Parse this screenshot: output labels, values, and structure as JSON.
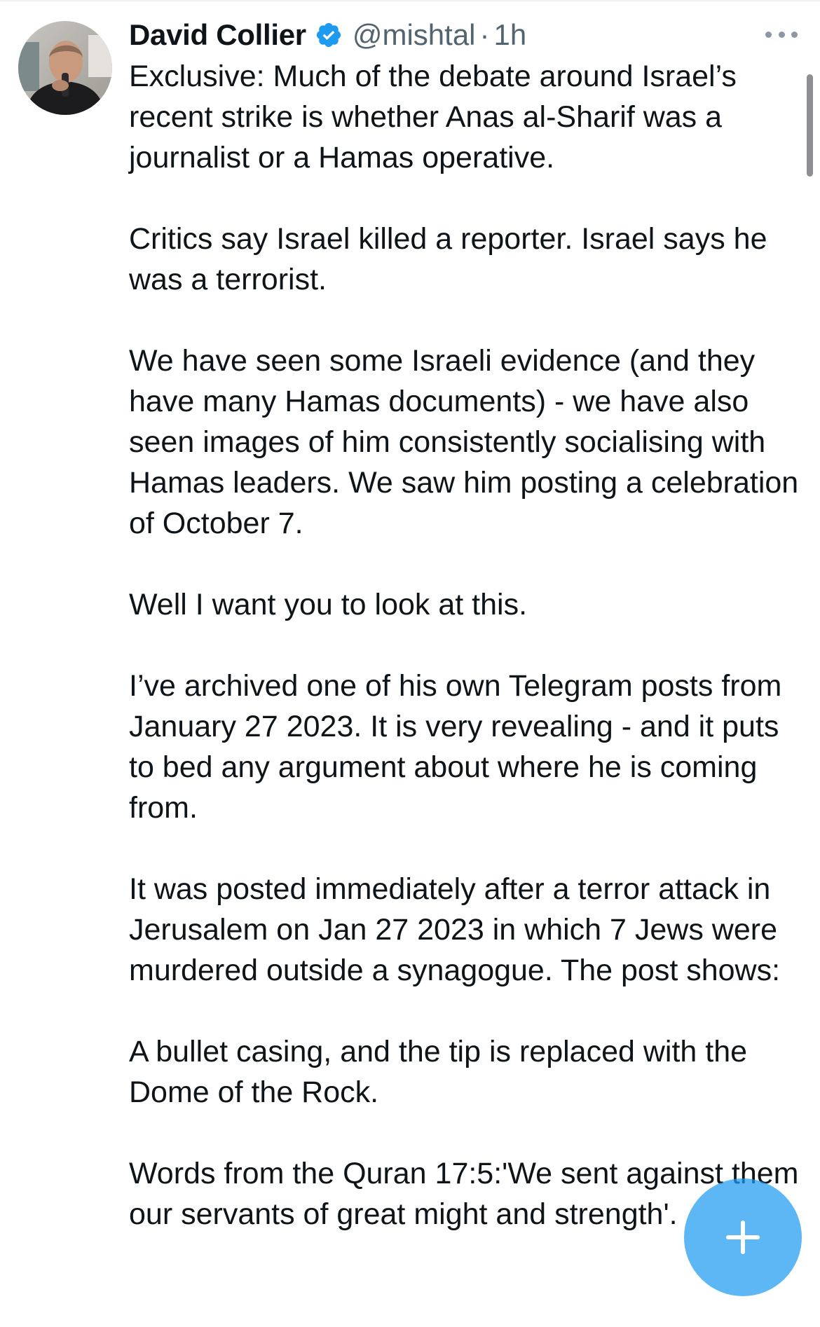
{
  "tweet": {
    "author_name": "David Collier",
    "handle": "@mishtal",
    "separator": "·",
    "time": "1h",
    "paragraphs": [
      "Exclusive: Much of the debate around Israel’s recent strike is whether Anas al-Sharif was a journalist or a Hamas operative.",
      "Critics say Israel killed a reporter. Israel says he was a terrorist.",
      "We have seen some Israeli evidence (and they have many Hamas documents) - we have also seen images of him consistently socialising with Hamas leaders. We saw him posting a celebration of October 7.",
      "Well I want you to look at this.",
      "I’ve archived one of his own Telegram posts from January 27 2023. It is very revealing - and it puts to bed any argument about where he is coming from.",
      "It was posted immediately after a terror attack in Jerusalem on Jan 27 2023  in which 7 Jews were murdered outside a synagogue. The post shows:",
      "A bullet casing, and the tip is replaced with the Dome of the Rock.",
      "Words from the Quran 17:5:'We sent against them our servants of great might and strength'."
    ]
  },
  "icons": {
    "verified": "verified-badge-icon",
    "more": "more-options-icon",
    "compose": "compose-plus-icon"
  },
  "colors": {
    "text": "#0f1419",
    "secondary_text": "#536471",
    "accent": "#1d9bf0"
  }
}
